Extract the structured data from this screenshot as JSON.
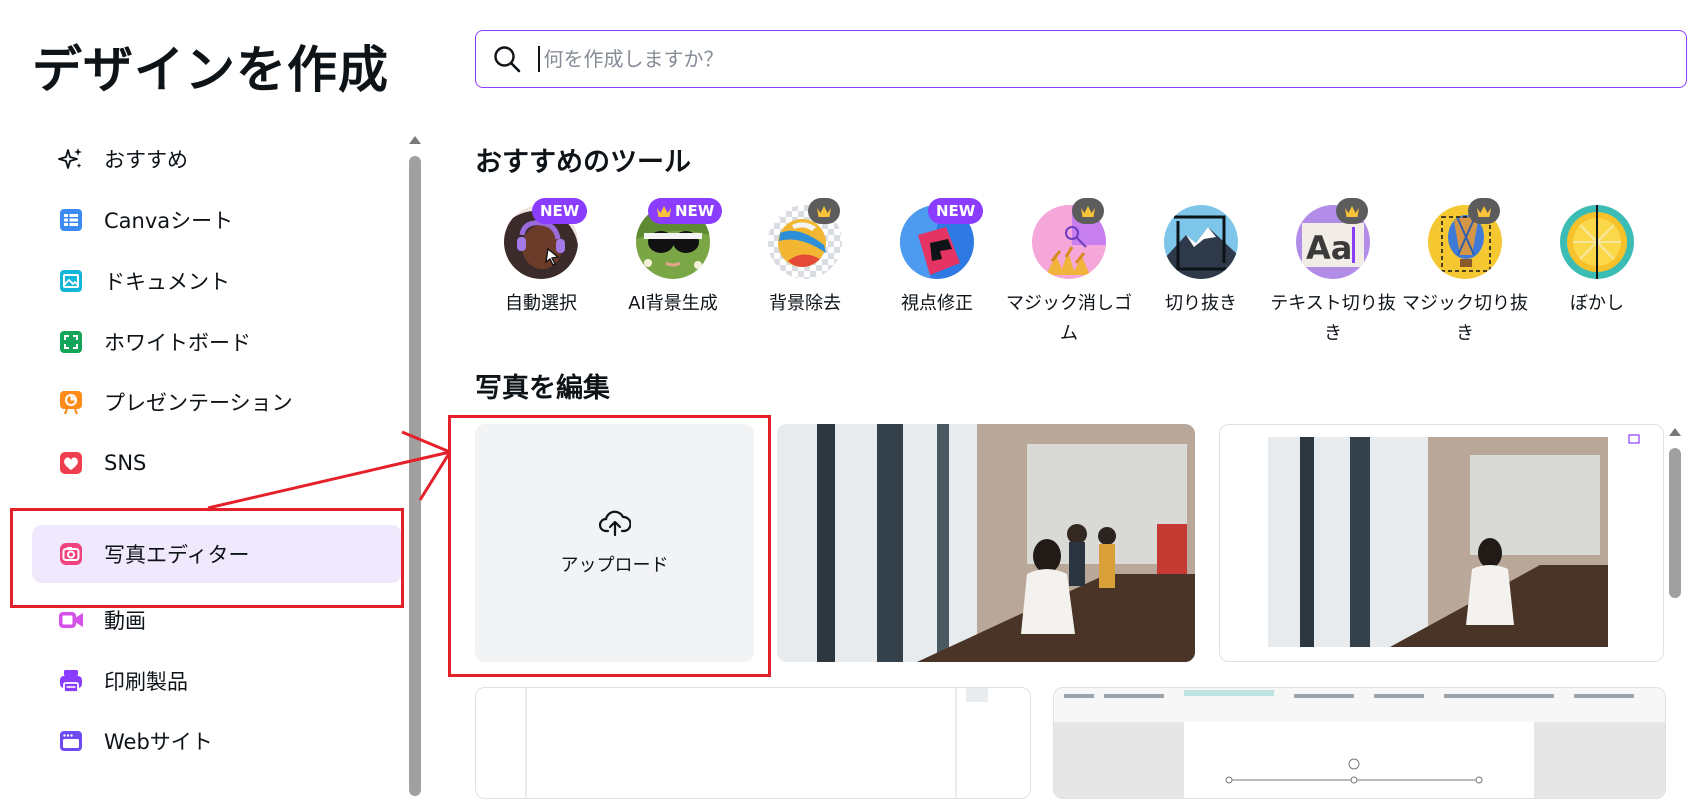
{
  "header": {
    "title": "デザインを作成",
    "search_placeholder": "何を作成しますか？"
  },
  "sidebar": {
    "items": [
      {
        "label": "おすすめ",
        "icon": "sparkle-icon",
        "color": "#0e1318"
      },
      {
        "label": "Canvaシート",
        "icon": "sheet-icon",
        "color": "#3d8bf2"
      },
      {
        "label": "ドキュメント",
        "icon": "document-icon",
        "color": "#13b5d8"
      },
      {
        "label": "ホワイトボード",
        "icon": "whiteboard-icon",
        "color": "#12a55a"
      },
      {
        "label": "プレゼンテーション",
        "icon": "presentation-icon",
        "color": "#ff8c1a"
      },
      {
        "label": "SNS",
        "icon": "heart-icon",
        "color": "#ef3f4f"
      },
      {
        "label": "写真エディター",
        "icon": "camera-icon",
        "color": "#f0447f"
      },
      {
        "label": "動画",
        "icon": "video-icon",
        "color": "#d452e8"
      },
      {
        "label": "印刷製品",
        "icon": "printer-icon",
        "color": "#8b3dff"
      },
      {
        "label": "Webサイト",
        "icon": "website-icon",
        "color": "#6e4bf0"
      }
    ],
    "active_index": 6
  },
  "tools_section": {
    "title": "おすすめのツール",
    "items": [
      {
        "label": "自動選択",
        "badge": "NEW",
        "crown": false
      },
      {
        "label": "AI背景生成",
        "badge": "NEW",
        "crown": true
      },
      {
        "label": "背景除去",
        "badge": "",
        "crown": true
      },
      {
        "label": "視点修正",
        "badge": "NEW",
        "crown": false
      },
      {
        "label": "マジック消しゴム",
        "badge": "",
        "crown": true
      },
      {
        "label": "切り抜き",
        "badge": "",
        "crown": false
      },
      {
        "label": "テキスト切り抜き",
        "badge": "",
        "crown": true
      },
      {
        "label": "マジック切り抜き",
        "badge": "",
        "crown": true
      },
      {
        "label": "ぼかし",
        "badge": "",
        "crown": false
      }
    ]
  },
  "edit_section": {
    "title": "写真を編集",
    "upload_label": "アップロード"
  },
  "colors": {
    "accent": "#8b3dff",
    "highlight": "#e5202a",
    "active_bg": "#f0e9fd"
  }
}
